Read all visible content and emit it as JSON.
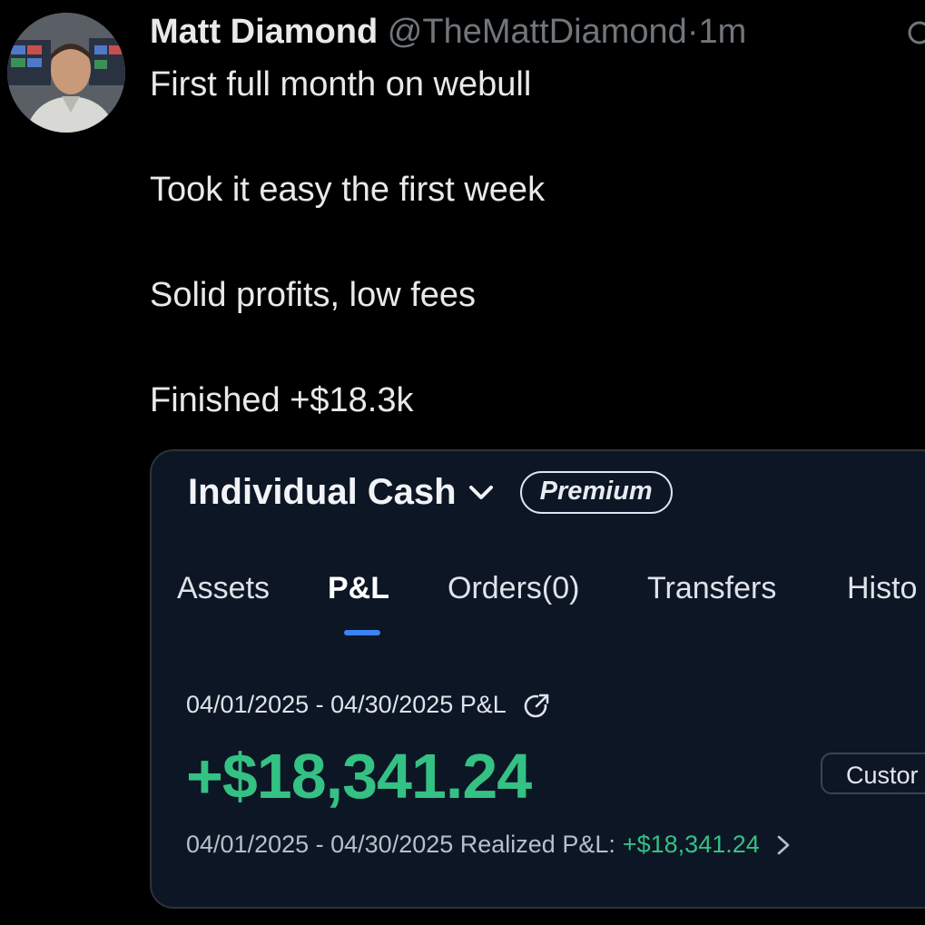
{
  "tweet": {
    "author_name": "Matt Diamond",
    "author_handle": "@TheMattDiamond",
    "separator": "·",
    "timestamp": "1m",
    "lines": [
      "First full month on webull",
      "Took it easy the first week",
      "Solid profits, low fees",
      "Finished +$18.3k"
    ]
  },
  "card": {
    "account_name": "Individual Cash",
    "badge": "Premium",
    "tabs": [
      {
        "label": "Assets",
        "active": false
      },
      {
        "label": "P&L",
        "active": true
      },
      {
        "label": "Orders(0)",
        "active": false
      },
      {
        "label": "Transfers",
        "active": false
      },
      {
        "label": "Histo",
        "active": false
      }
    ],
    "period_label": "04/01/2025 - 04/30/2025 P&L",
    "pnl_value": "+$18,341.24",
    "custom_button_label": "Custor",
    "realized_label": "04/01/2025 - 04/30/2025 Realized P&L:",
    "realized_value": "+$18,341.24"
  },
  "colors": {
    "background": "#000000",
    "card_background": "#0d1625",
    "profit_green": "#34c184",
    "tab_indicator_blue": "#3b82f6",
    "handle_gray": "#71767b"
  },
  "icons": [
    "avatar",
    "more-icon",
    "chevron-down-icon",
    "share-icon",
    "chevron-right-icon"
  ]
}
